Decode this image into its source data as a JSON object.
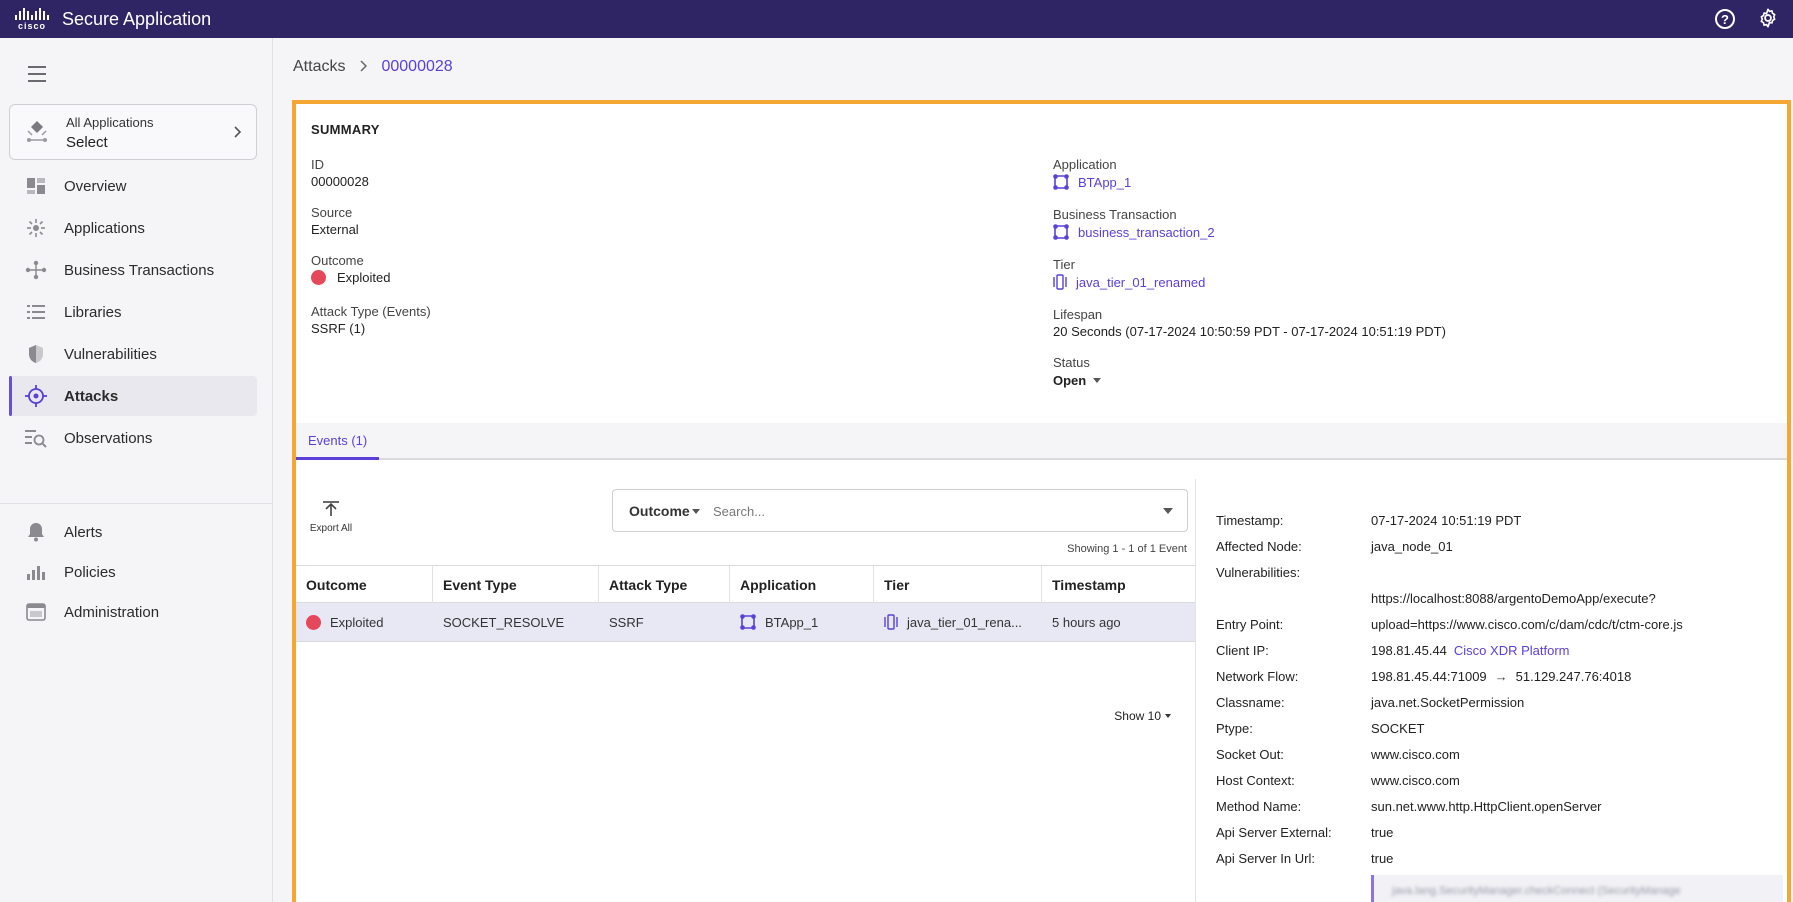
{
  "header": {
    "brand": "cisco",
    "title": "Secure Application",
    "help_glyph": "?"
  },
  "sidebar": {
    "app_select": {
      "label": "All Applications",
      "value": "Select"
    },
    "items": [
      {
        "label": "Overview",
        "icon": "overview-icon"
      },
      {
        "label": "Applications",
        "icon": "applications-icon"
      },
      {
        "label": "Business Transactions",
        "icon": "business-transactions-icon"
      },
      {
        "label": "Libraries",
        "icon": "libraries-icon"
      },
      {
        "label": "Vulnerabilities",
        "icon": "shield-icon"
      },
      {
        "label": "Attacks",
        "icon": "target-icon",
        "active": true
      },
      {
        "label": "Observations",
        "icon": "observations-icon"
      },
      {
        "label": "Alerts",
        "icon": "bell-icon"
      },
      {
        "label": "Policies",
        "icon": "bar-chart-icon"
      },
      {
        "label": "Administration",
        "icon": "window-icon"
      }
    ]
  },
  "breadcrumb": {
    "parent": "Attacks",
    "current": "00000028"
  },
  "summary": {
    "title": "SUMMARY",
    "id_label": "ID",
    "id_value": "00000028",
    "source_label": "Source",
    "source_value": "External",
    "outcome_label": "Outcome",
    "outcome_value": "Exploited",
    "attack_type_label": "Attack Type (Events)",
    "attack_type_value": "SSRF (1)",
    "application_label": "Application",
    "application_value": "BTApp_1",
    "bt_label": "Business Transaction",
    "bt_value": "business_transaction_2",
    "tier_label": "Tier",
    "tier_value": "java_tier_01_renamed",
    "lifespan_label": "Lifespan",
    "lifespan_value": "20 Seconds (07-17-2024 10:50:59 PDT - 07-17-2024 10:51:19 PDT)",
    "status_label": "Status",
    "status_value": "Open"
  },
  "tabs": [
    {
      "label": "Events (1)",
      "active": true
    }
  ],
  "events": {
    "export_label": "Export All",
    "filter_label": "Outcome",
    "search_placeholder": "Search...",
    "showing": "Showing 1 - 1 of 1 Event",
    "columns": [
      "Outcome",
      "Event Type",
      "Attack Type",
      "Application",
      "Tier",
      "Timestamp"
    ],
    "rows": [
      {
        "outcome": "Exploited",
        "event_type": "SOCKET_RESOLVE",
        "attack_type": "SSRF",
        "application": "BTApp_1",
        "tier": "java_tier_01_rena...",
        "timestamp": "5 hours ago"
      }
    ],
    "page_size": "Show 10"
  },
  "details": {
    "timestamp_label": "Timestamp:",
    "timestamp_value": "07-17-2024 10:51:19 PDT",
    "node_label": "Affected Node:",
    "node_value": "java_node_01",
    "vuln_label": "Vulnerabilities:",
    "vuln_value": "",
    "url_value": "https://localhost:8088/argentoDemoApp/execute?",
    "entry_label": "Entry Point:",
    "entry_value": "upload=https://www.cisco.com/c/dam/cdc/t/ctm-core.js",
    "client_ip_label": "Client IP:",
    "client_ip_value": "198.81.45.44",
    "client_ip_link": "Cisco XDR Platform",
    "flow_label": "Network Flow:",
    "flow_from": "198.81.45.44:71009",
    "flow_arrow": "→",
    "flow_to": "51.129.247.76:4018",
    "classname_label": "Classname:",
    "classname_value": "java.net.SocketPermission",
    "ptype_label": "Ptype:",
    "ptype_value": "SOCKET",
    "socket_out_label": "Socket Out:",
    "socket_out_value": "www.cisco.com",
    "host_label": "Host Context:",
    "host_value": "www.cisco.com",
    "method_label": "Method Name:",
    "method_value": "sun.net.www.http.HttpClient.openServer",
    "api_ext_label": "Api Server External:",
    "api_ext_value": "true",
    "api_url_label": "Api Server In Url:",
    "api_url_value": "true",
    "stack_preview": "java.lang.SecurityManager.checkConnect (SecurityManage"
  },
  "colors": {
    "topbar": "#2f2464",
    "accent": "#5b3fd6",
    "highlight": "#f4a732",
    "exploited": "#e5485a"
  }
}
